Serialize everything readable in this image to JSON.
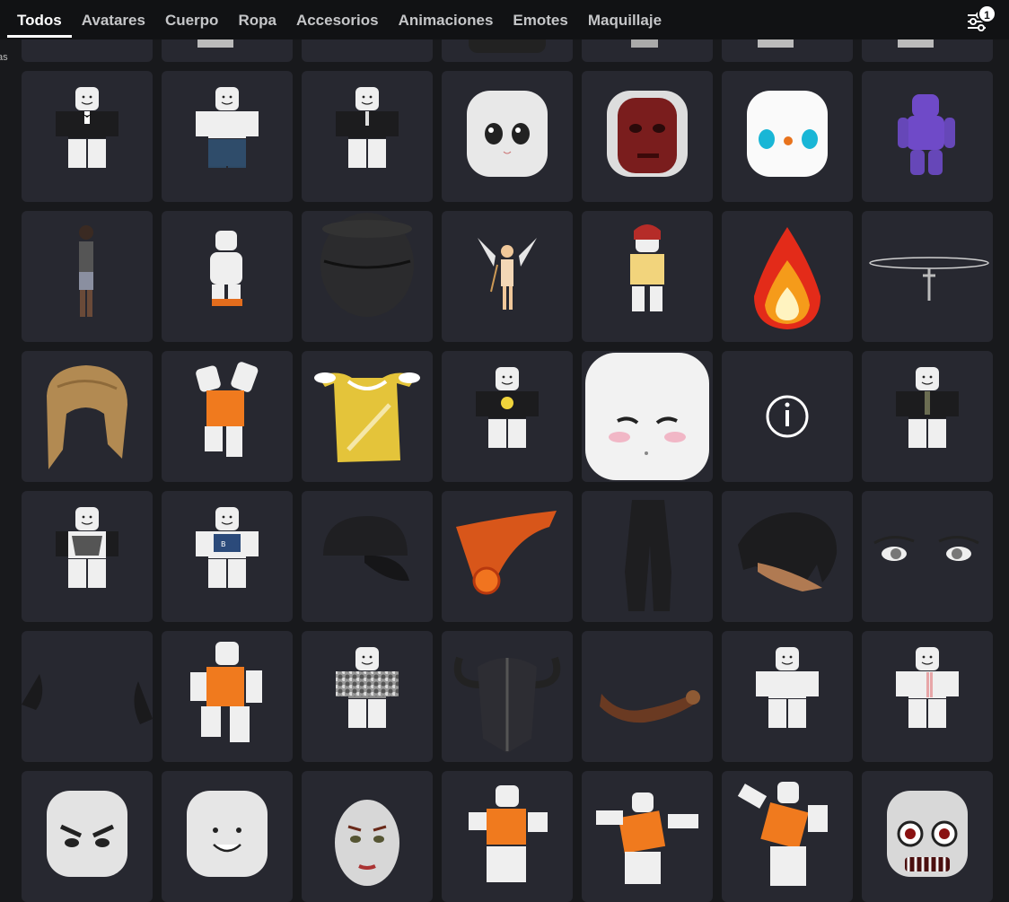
{
  "tabs": [
    {
      "label": "Todos",
      "active": true
    },
    {
      "label": "Avatares",
      "active": false
    },
    {
      "label": "Cuerpo",
      "active": false
    },
    {
      "label": "Ropa",
      "active": false
    },
    {
      "label": "Accesorios",
      "active": false
    },
    {
      "label": "Animaciones",
      "active": false
    },
    {
      "label": "Emotes",
      "active": false
    },
    {
      "label": "Maquillaje",
      "active": false
    }
  ],
  "filter": {
    "icon": "filter-sliders-icon",
    "badge_count": "1"
  },
  "side_text": "as",
  "colors": {
    "background": "#18191c",
    "topbar": "#111214",
    "tile": "#272830"
  },
  "items": [
    "face-item",
    "head-item",
    "face-item",
    "pants-item",
    "avatar-item",
    "head-item",
    "head-item",
    "tuxedo-shirt",
    "white-shirt-jeans",
    "black-suit-shirt",
    "anime-face-head",
    "flesh-mask-head",
    "robot-face-head",
    "purple-body",
    "dark-avatar",
    "white-avatar",
    "black-hat",
    "angel-avatar",
    "red-hair-avatar",
    "fire-effect",
    "dagger-necklace",
    "straw-hair",
    "orange-shirt-avatar",
    "yellow-cape",
    "smiley-shirt",
    "blush-face-head",
    "info-placeholder",
    "green-tie-suit",
    "cat-shirt",
    "blue-graphic-shirt",
    "black-cap",
    "chain-necklace",
    "black-pants",
    "black-hair",
    "anime-eyes",
    "cat-ears",
    "orange-shirt-body",
    "camo-shirt",
    "horned-helmet",
    "brown-arm",
    "white-body",
    "pink-shirt",
    "angry-head",
    "smile-head",
    "woman-head",
    "orange-emote-1",
    "orange-emote-2",
    "orange-emote-3",
    "scary-head"
  ]
}
